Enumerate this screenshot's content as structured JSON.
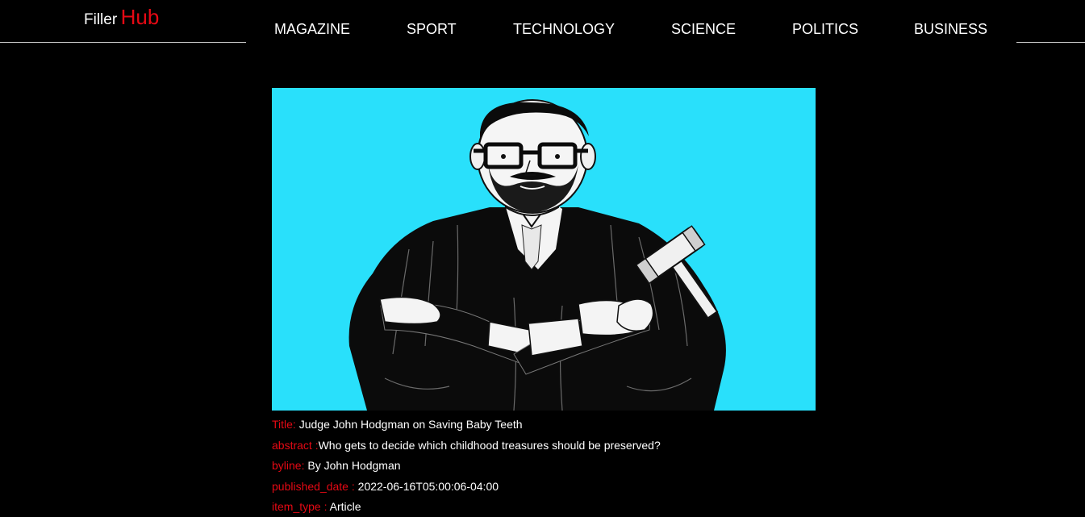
{
  "brand": {
    "part1": "Filler",
    "part2": "Hub",
    "accent_color": "#e50914"
  },
  "nav": {
    "items": [
      {
        "label": "MAGAZINE"
      },
      {
        "label": "SPORT"
      },
      {
        "label": "TECHNOLOGY"
      },
      {
        "label": "SCIENCE"
      },
      {
        "label": "POLITICS"
      },
      {
        "label": "BUSINESS"
      }
    ]
  },
  "article": {
    "image": {
      "icon": "judge-illustration",
      "background_color": "#29e0fb"
    },
    "fields": {
      "title_key": "Title:",
      "title_value": " Judge John Hodgman on Saving Baby Teeth",
      "abstract_key": "abstract :",
      "abstract_value": "Who gets to decide which childhood treasures should be preserved?",
      "byline_key": "byline:",
      "byline_value": " By John Hodgman",
      "published_key": "published_date :",
      "published_value": " 2022-06-16T05:00:06-04:00",
      "item_type_key": "item_type :",
      "item_type_value": " Article"
    }
  }
}
